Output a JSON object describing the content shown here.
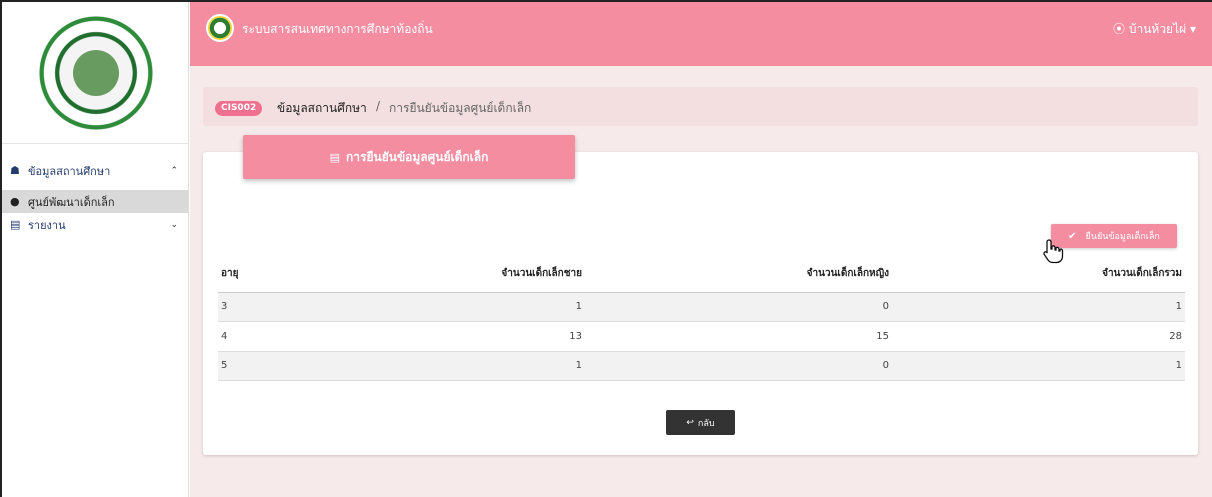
{
  "header": {
    "brand": "ระบบสารสนเทศทางการศึกษาท้องถิ่น",
    "user": "⦿ บ้านห้วยไผ่ ▾"
  },
  "sidebar": {
    "items": [
      {
        "icon": "graduation-cap-icon",
        "glyph": "☗",
        "label": "ข้อมูลสถานศึกษา",
        "chevron": "⌃"
      },
      {
        "icon": "dot-icon",
        "glyph": "●",
        "label": "ศูนย์พัฒนาเด็กเล็ก"
      },
      {
        "icon": "file-icon",
        "glyph": "▤",
        "label": "รายงาน",
        "chevron": "⌄"
      }
    ]
  },
  "breadcrumb": {
    "code": "CIS002",
    "section": "ข้อมูลสถานศึกษา",
    "separator": "/",
    "page": "การยืนยันข้อมูลศูนย์เด็กเล็ก"
  },
  "card": {
    "title_icon": "▤",
    "title": "การยืนยันข้อมูลศูนย์เด็กเล็ก",
    "confirm_icon": "✔",
    "confirm_label": "ยืนยันข้อมูลเด็กเล็ก",
    "back_icon": "↩",
    "back_label": "กลับ"
  },
  "table": {
    "headers": [
      "อายุ",
      "จำนวนเด็กเล็กชาย",
      "จำนวนเด็กเล็กหญิง",
      "จำนวนเด็กเล็กรวม"
    ],
    "rows": [
      [
        "3",
        "1",
        "0",
        "1"
      ],
      [
        "4",
        "13",
        "15",
        "28"
      ],
      [
        "5",
        "1",
        "0",
        "1"
      ]
    ]
  },
  "colors": {
    "accent": "#f58da1",
    "badge": "#f07090",
    "content_bg": "#f7eaea"
  }
}
